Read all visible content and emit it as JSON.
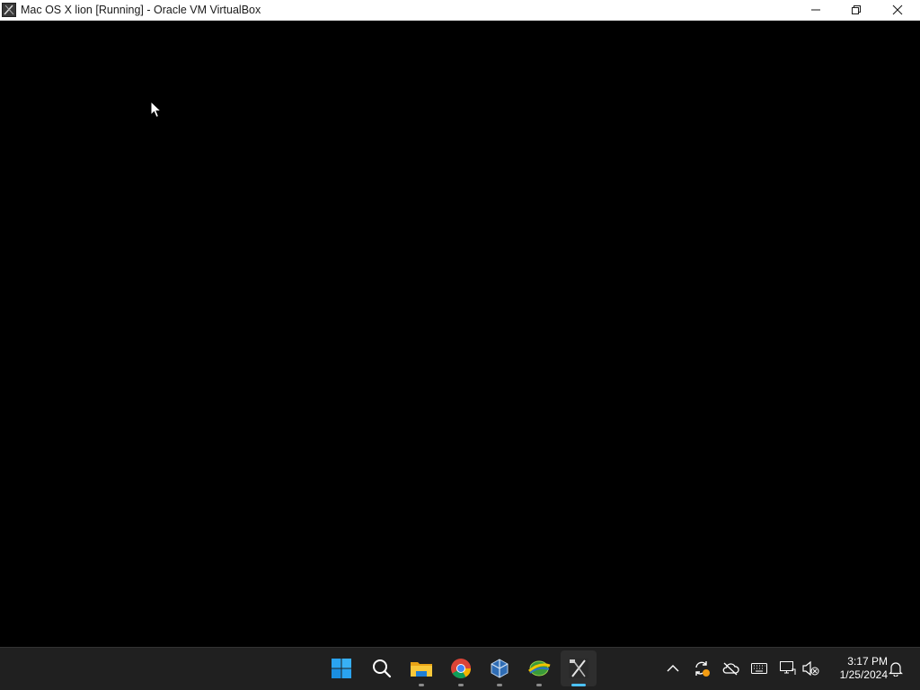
{
  "window": {
    "title": "Mac OS X lion [Running] - Oracle VM VirtualBox",
    "app_icon": "virtualbox-vm-icon",
    "controls": {
      "minimize": "minimize-icon",
      "maximize": "restore-icon",
      "close": "close-icon"
    }
  },
  "vm_screen": {
    "background_color": "#000000",
    "cursor": "mouse-pointer-icon"
  },
  "taskbar": {
    "pinned": [
      {
        "name": "start",
        "icon": "windows-start-icon",
        "running": false
      },
      {
        "name": "search",
        "icon": "search-icon",
        "running": false
      },
      {
        "name": "file-explorer",
        "icon": "folder-icon",
        "running": true
      },
      {
        "name": "chrome",
        "icon": "chrome-icon",
        "running": true
      },
      {
        "name": "virtualbox",
        "icon": "virtualbox-icon",
        "running": true
      },
      {
        "name": "internet-download",
        "icon": "globe-download-icon",
        "running": true
      },
      {
        "name": "mac-os-vm",
        "icon": "vm-window-icon",
        "running": true,
        "active": true
      }
    ],
    "tray": {
      "chevron": "chevron-up-icon",
      "icons": [
        "sync-warning-icon",
        "cloud-offline-icon",
        "keyboard-icon",
        "network-icon",
        "volume-muted-icon"
      ],
      "time": "3:17 PM",
      "date": "1/25/2024",
      "notifications": "bell-icon"
    }
  },
  "colors": {
    "taskbar_bg": "#202020",
    "accent": "#4cc2ff",
    "titlebar_bg": "#ffffff"
  }
}
